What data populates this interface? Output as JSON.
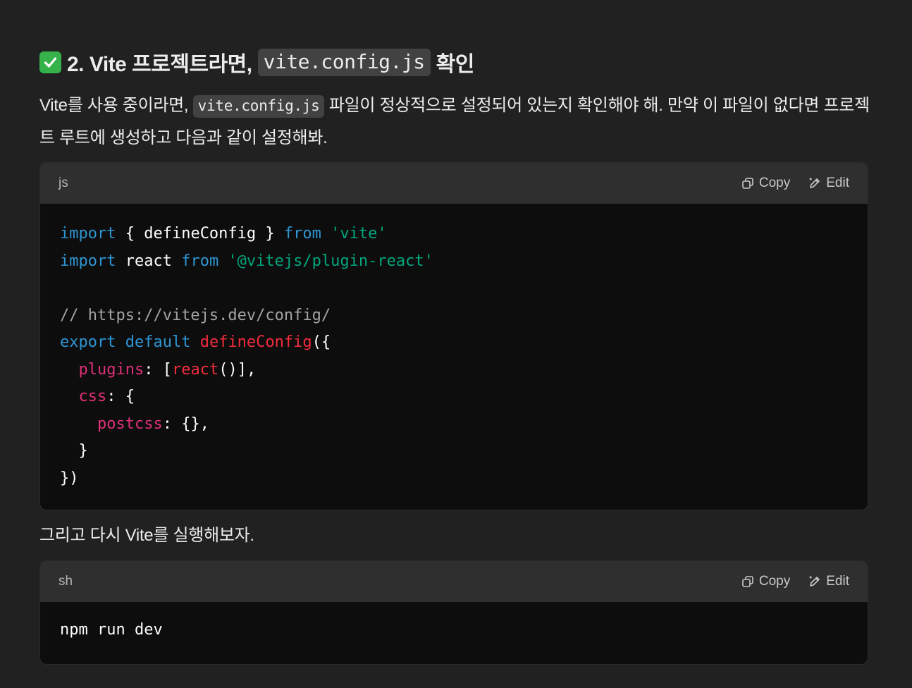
{
  "heading": {
    "icon": "white-check-mark-icon",
    "prefix": "2. Vite 프로젝트라면,",
    "code": "vite.config.js",
    "suffix": "확인"
  },
  "paragraph1": {
    "before": "Vite를 사용 중이라면,",
    "code": "vite.config.js",
    "after": "파일이 정상적으로 설정되어 있는지 확인해야 해. 만약 이 파일이 없다면 프로젝트 루트에 생성하고 다음과 같이 설정해봐."
  },
  "code_block_1": {
    "language": "js",
    "copy_label": "Copy",
    "edit_label": "Edit",
    "lines": [
      [
        {
          "t": "import",
          "c": "kw"
        },
        {
          "t": " { defineConfig } ",
          "c": "pl"
        },
        {
          "t": "from",
          "c": "kw"
        },
        {
          "t": " ",
          "c": "pl"
        },
        {
          "t": "'vite'",
          "c": "str"
        }
      ],
      [
        {
          "t": "import",
          "c": "kw"
        },
        {
          "t": " react ",
          "c": "pl"
        },
        {
          "t": "from",
          "c": "kw"
        },
        {
          "t": " ",
          "c": "pl"
        },
        {
          "t": "'@vitejs/plugin-react'",
          "c": "str"
        }
      ],
      [],
      [
        {
          "t": "// https://vitejs.dev/config/",
          "c": "cm"
        }
      ],
      [
        {
          "t": "export",
          "c": "kw"
        },
        {
          "t": " ",
          "c": "pl"
        },
        {
          "t": "default",
          "c": "kw"
        },
        {
          "t": " ",
          "c": "pl"
        },
        {
          "t": "defineConfig",
          "c": "fn"
        },
        {
          "t": "({",
          "c": "pl"
        }
      ],
      [
        {
          "t": "  ",
          "c": "pl"
        },
        {
          "t": "plugins",
          "c": "prop"
        },
        {
          "t": ": [",
          "c": "pl"
        },
        {
          "t": "react",
          "c": "fn"
        },
        {
          "t": "()],",
          "c": "pl"
        }
      ],
      [
        {
          "t": "  ",
          "c": "pl"
        },
        {
          "t": "css",
          "c": "prop"
        },
        {
          "t": ": {",
          "c": "pl"
        }
      ],
      [
        {
          "t": "    ",
          "c": "pl"
        },
        {
          "t": "postcss",
          "c": "prop"
        },
        {
          "t": ": {},",
          "c": "pl"
        }
      ],
      [
        {
          "t": "  }",
          "c": "pl"
        }
      ],
      [
        {
          "t": "})",
          "c": "pl"
        }
      ]
    ]
  },
  "paragraph2": {
    "text": "그리고 다시 Vite를 실행해보자."
  },
  "code_block_2": {
    "language": "sh",
    "copy_label": "Copy",
    "edit_label": "Edit",
    "lines": [
      [
        {
          "t": "npm run dev",
          "c": "pl"
        }
      ]
    ]
  },
  "colors": {
    "background": "#212121",
    "code_background": "#0d0d0d",
    "code_header": "#2f2f2f",
    "keyword": "#2e95d3",
    "string": "#00a67d",
    "comment": "#a3a3a3",
    "function": "#f22c3d",
    "property": "#df3079"
  }
}
